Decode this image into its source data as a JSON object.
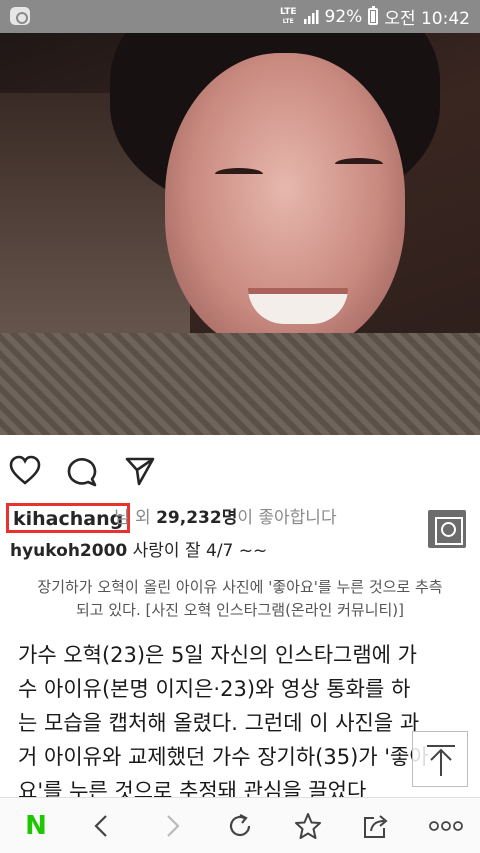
{
  "status_bar": {
    "network": "LTE",
    "network_sub": "LTE",
    "battery": "92%",
    "time": "오전 10:42"
  },
  "post": {
    "username": "kihachang",
    "likes_prefix": "님 외 ",
    "likes_count": "29,232명",
    "likes_suffix": "이 좋아합니다",
    "comment_user": "hyukoh2000",
    "comment_text": " 사랑이 잘 4/7 ~~"
  },
  "caption": {
    "line1": "장기하가 오혁이 올린 아이유 사진에 '좋아요'를 누른 것으로 추측",
    "line2": "되고 있다. [사진 오혁 인스타그램(온라인 커뮤니티)]"
  },
  "article": {
    "lines": [
      "가수 오혁(23)은 5일 자신의 인스타그램에 가",
      "수 아이유(본명 이지은·23)와 영상 통화를 하",
      "는 모습을 캡처해 올렸다. 그런데 이 사진을 과",
      "거 아이유와 교제했던 가수 장기하(35)가 '좋아",
      "요'를 누른 것으로 추정돼 관심을 끌었다"
    ]
  },
  "bottom_bar": {
    "home_label": "N",
    "more_label": "ooo"
  },
  "colors": {
    "highlight": "#e8322f",
    "naver_green": "#1ec800",
    "statusbar": "#8a8a8a"
  },
  "icons": [
    "heart-icon",
    "comment-icon",
    "send-icon",
    "lens-icon",
    "scroll-top-icon",
    "back-icon",
    "forward-icon",
    "refresh-icon",
    "bookmark-star-icon",
    "share-icon",
    "more-icon"
  ]
}
